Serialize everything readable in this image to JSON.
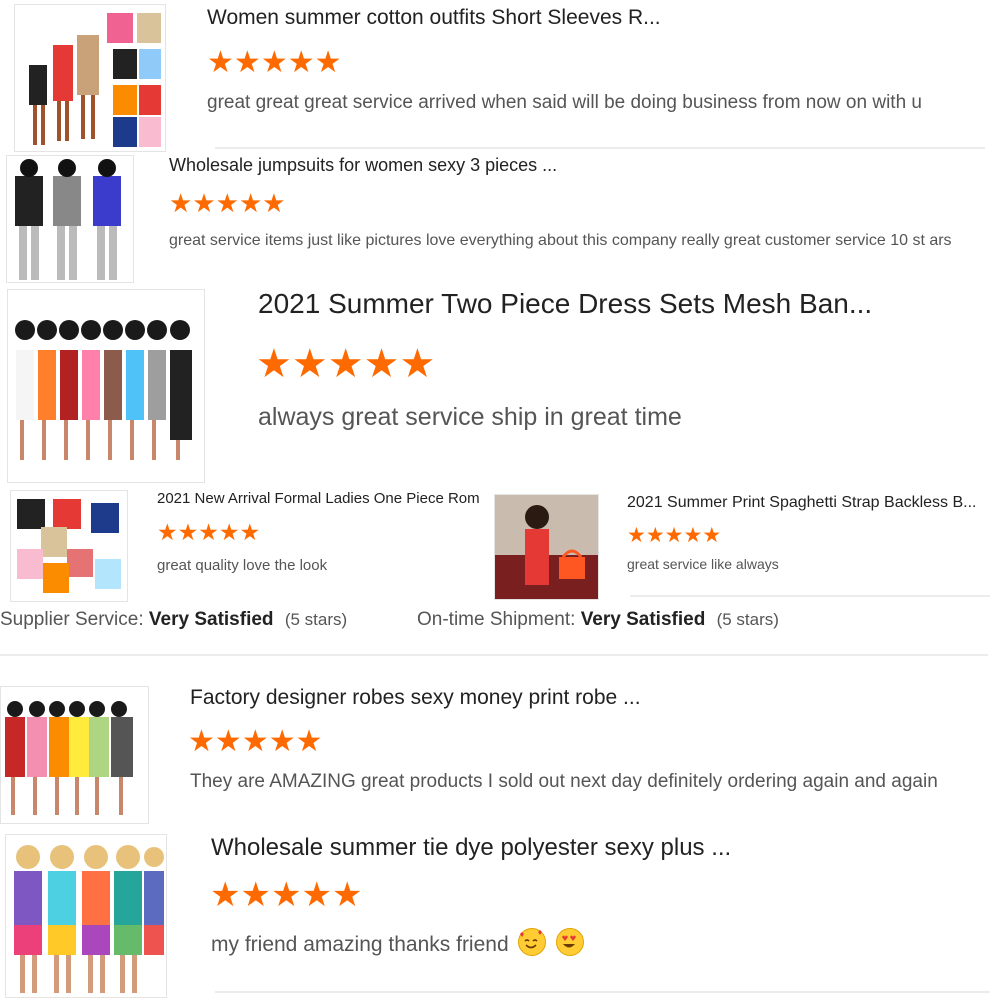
{
  "reviews": [
    {
      "title": "Women summer cotton outfits Short Sleeves R...",
      "rating": 5,
      "comment": "great great great service arrived when said will be doing business from now on with u"
    },
    {
      "title": "Wholesale jumpsuits for women sexy 3 pieces ...",
      "rating": 5,
      "comment": "great service items just like pictures love everything about this company really great customer service 10 st ars"
    },
    {
      "title": "2021 Summer Two Piece Dress Sets Mesh Ban...",
      "rating": 5,
      "comment": "always great service ship in great time"
    },
    {
      "title": "2021 New Arrival Formal Ladies One Piece Rom",
      "rating": 5,
      "comment": "great quality love the look"
    },
    {
      "title": "2021 Summer Print Spaghetti Strap Backless B...",
      "rating": 5,
      "comment": "great service like always"
    },
    {
      "title": "Factory designer robes sexy money print robe ...",
      "rating": 5,
      "comment": "They are AMAZING great products I sold out next day definitely ordering again and again"
    },
    {
      "title": "Wholesale summer tie dye polyester sexy plus ...",
      "rating": 5,
      "comment": "my friend amazing thanks friend"
    }
  ],
  "summary": {
    "supplier_label": "Supplier Service:",
    "supplier_value": "Very Satisfied",
    "supplier_stars": "(5 stars)",
    "shipment_label": "On-time Shipment:",
    "shipment_value": "Very Satisfied",
    "shipment_stars": "(5 stars)"
  },
  "colors": {
    "star": "#ff6a00"
  },
  "icons": {
    "rating": "star-icon",
    "emoji1": "smiling-face-with-hearts-icon",
    "emoji2": "heart-eyes-face-icon"
  }
}
